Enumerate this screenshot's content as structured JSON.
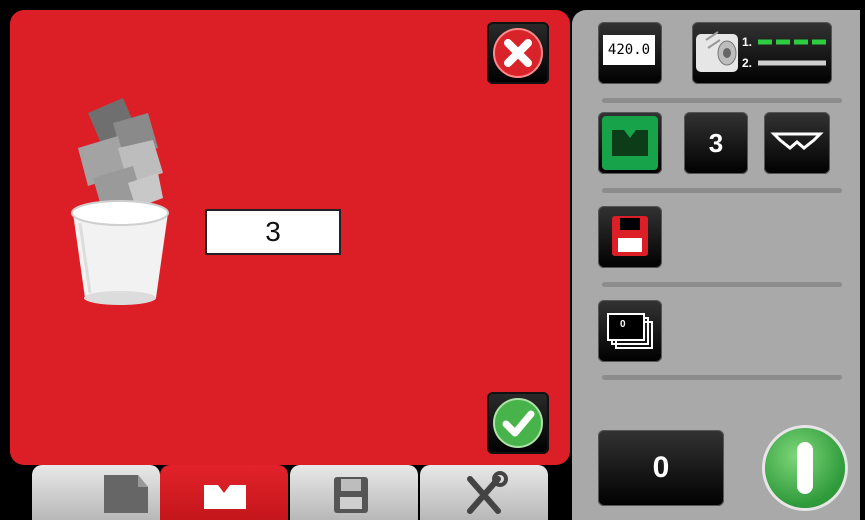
{
  "dialog": {
    "count_value": "3",
    "close_label": "close-icon",
    "confirm_label": "check-icon",
    "illustration": "trash-bin-icon"
  },
  "tabs": [
    {
      "name": "document-tab",
      "icon": "document-icon",
      "active": false
    },
    {
      "name": "feed-tab",
      "icon": "feed-tray-icon",
      "active": true
    },
    {
      "name": "save-tab",
      "icon": "floppy-icon",
      "active": false
    },
    {
      "name": "tools-tab",
      "icon": "tools-icon",
      "active": false
    }
  ],
  "panel": {
    "length_display": "420.0",
    "roll_labels": [
      "1.",
      "2."
    ],
    "feed_count": "3",
    "stack_count": "0",
    "counter_value": "0",
    "power_label": "power-icon"
  },
  "colors": {
    "dialog_red": "#dc1f26",
    "panel_grey": "#a9a9a9",
    "feed_green": "#16a34a",
    "save_red": "#dc1f26"
  }
}
